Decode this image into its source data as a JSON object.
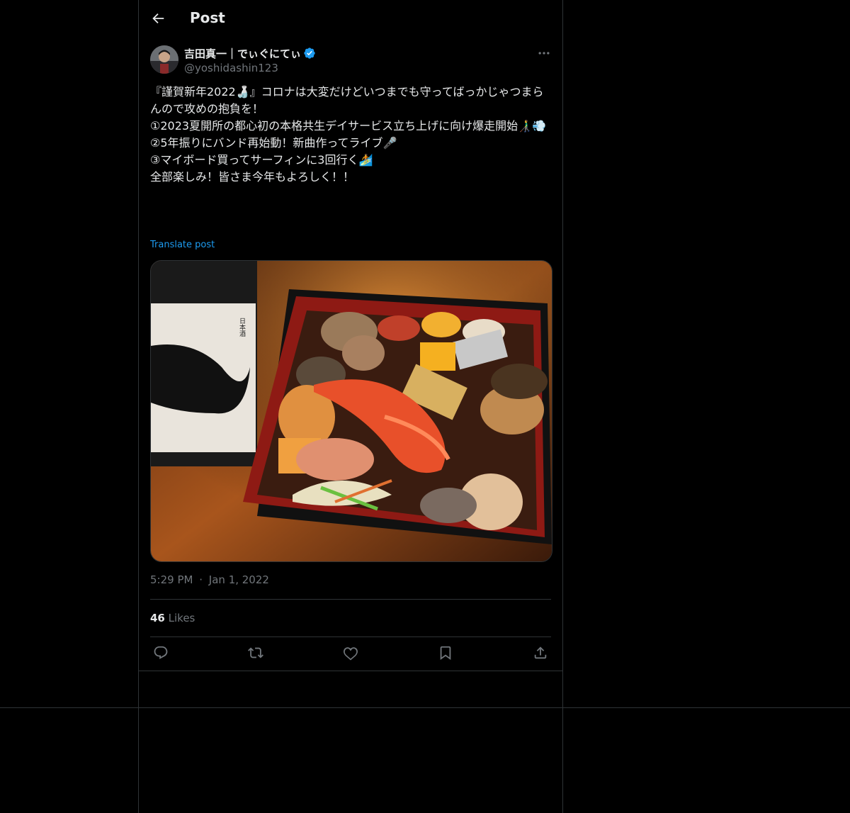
{
  "header": {
    "title": "Post"
  },
  "author": {
    "name": "吉田真一｜でぃぐにてぃ",
    "handle": "@yoshidashin123"
  },
  "post": {
    "lines": [
      "『謹賀新年2022🍶』コロナは大変だけどいつまでも守ってばっかじゃつまらんので攻めの抱負を！",
      "",
      "①2023夏開所の都心初の本格共生デイサービス立ち上げに向け爆走開始👨‍🦯💨",
      "②5年振りにバンド再始動！新曲作ってライブ🎤",
      "③マイボード買ってサーフィンに3回行く🏄",
      "",
      "全部楽しみ！皆さま今年もよろしく！！"
    ],
    "translate_label": "Translate post",
    "time": "5:29 PM",
    "separator": "·",
    "date": "Jan 1, 2022",
    "likes_count": "46",
    "likes_label": "Likes"
  },
  "icons": {
    "back": "back-arrow-icon",
    "verified": "verified-badge-icon",
    "more": "more-icon",
    "reply": "reply-icon",
    "repost": "repost-icon",
    "like": "like-icon",
    "bookmark": "bookmark-icon",
    "share": "share-icon"
  },
  "colors": {
    "background": "#000000",
    "text": "#e7e9ea",
    "secondary": "#71767b",
    "accent": "#1d9bf0",
    "border": "#2f3336"
  }
}
